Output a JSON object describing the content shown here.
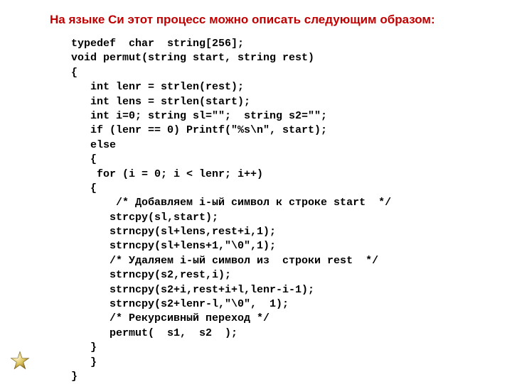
{
  "heading": "На языке Си этот процесс можно описать следующим образом:",
  "code": {
    "l01": "typedef  char  string[256];",
    "l02": "void permut(string start, string rest)",
    "l03": "{",
    "l04": "   int lenr = strlen(rest);",
    "l05": "   int lens = strlen(start);",
    "l06": "   int i=0; string sl=\"\";  string s2=\"\";",
    "l07": "   if (lenr == 0) Printf(\"%s\\n\", start);",
    "l08": "   else",
    "l09": "   {",
    "l10": "    for (i = 0; i < lenr; i++)",
    "l11": "   {",
    "l12": "       /* Добавляем i-ый символ к строке start  */",
    "l13": "      strcpy(sl,start);",
    "l14": "      strncpy(sl+lens,rest+i,1);",
    "l15": "      strncpy(sl+lens+1,\"\\0\",1);",
    "l16": "      /* Удаляем i-ый символ из  строки rest  */",
    "l17": "      strncpy(s2,rest,i);",
    "l18": "      strncpy(s2+i,rest+i+l,lenr-i-1);",
    "l19": "      strncpy(s2+lenr-l,\"\\0\",  1);",
    "l20": "      /* Рекурсивный переход */",
    "l21": "      permut(  s1,  s2  );",
    "l22": "   }",
    "l23": "   }",
    "l24": "}"
  }
}
